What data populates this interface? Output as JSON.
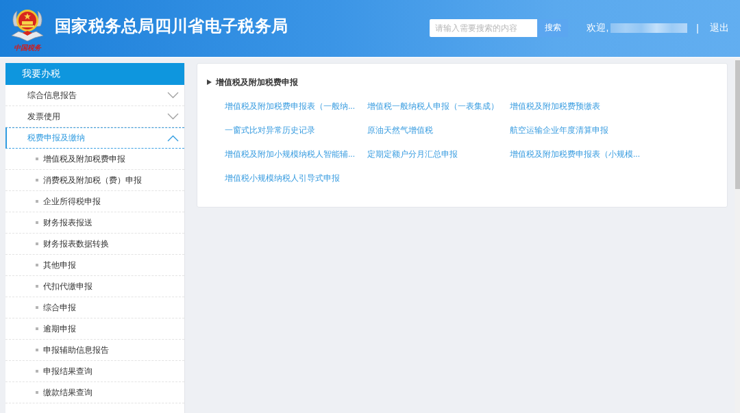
{
  "header": {
    "logo_caption": "中国税务",
    "title": "国家税务总局四川省电子税务局"
  },
  "search": {
    "placeholder": "请输入需要搜索的内容",
    "button": "搜索"
  },
  "user": {
    "greeting": "欢迎,",
    "separator": "|",
    "logout": "退出"
  },
  "sidebar": {
    "title": "我要办税",
    "items": [
      {
        "label": "综合信息报告",
        "expanded": false
      },
      {
        "label": "发票使用",
        "expanded": false
      },
      {
        "label": "税费申报及缴纳",
        "expanded": true,
        "children": [
          {
            "label": "增值税及附加税费申报"
          },
          {
            "label": "消费税及附加税（费）申报"
          },
          {
            "label": "企业所得税申报"
          },
          {
            "label": "财务报表报送"
          },
          {
            "label": "财务报表数据转换"
          },
          {
            "label": "其他申报"
          },
          {
            "label": "代扣代缴申报"
          },
          {
            "label": "综合申报"
          },
          {
            "label": "逾期申报"
          },
          {
            "label": "申报辅助信息报告"
          },
          {
            "label": "申报结果查询"
          },
          {
            "label": "缴款结果查询"
          }
        ]
      }
    ]
  },
  "content": {
    "section_title": "增值税及附加税费申报",
    "links": [
      "增值税及附加税费申报表（一般纳...",
      "增值税一般纳税人申报（一表集成）",
      "增值税及附加税费预缴表",
      "一窗式比对异常历史记录",
      "原油天然气增值税",
      "航空运输企业年度清算申报",
      "增值税及附加小规模纳税人智能辅...",
      "定期定额户分月汇总申报",
      "增值税及附加税费申报表（小规模...",
      "增值税小规模纳税人引导式申报"
    ]
  }
}
